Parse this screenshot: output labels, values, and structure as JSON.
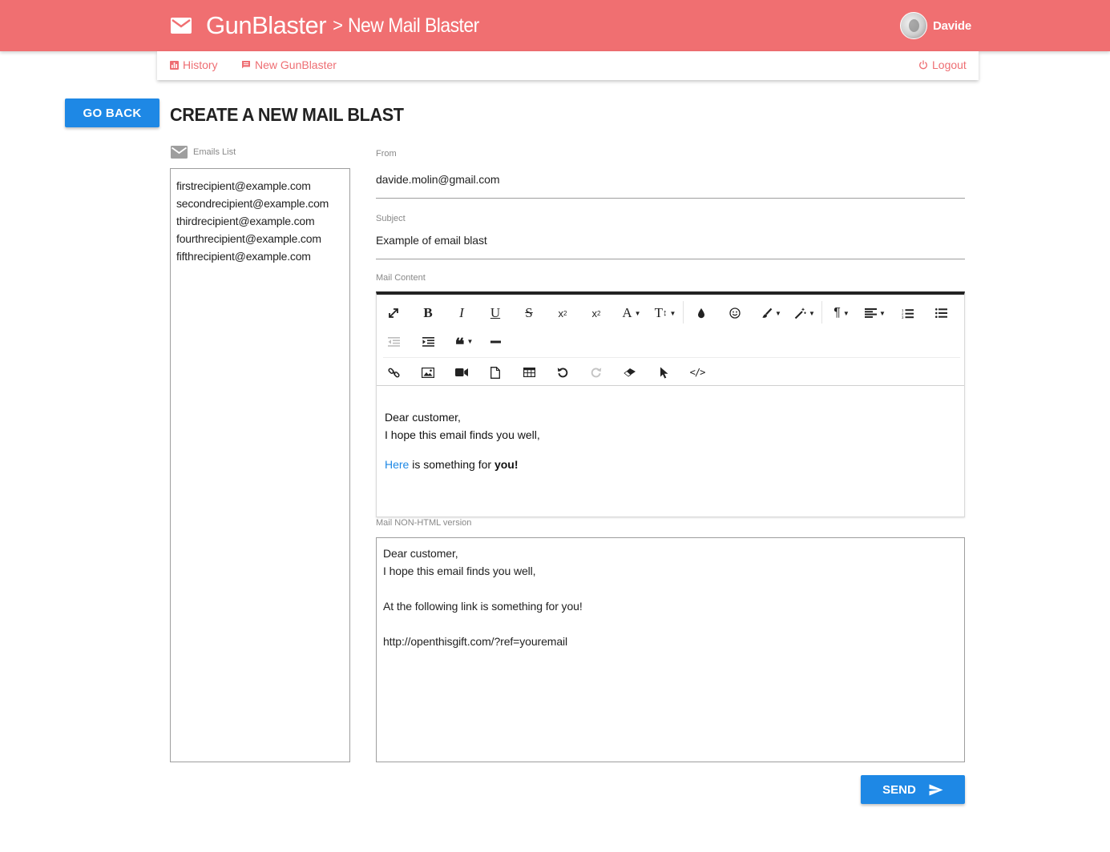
{
  "header": {
    "app_name": "GunBlaster",
    "separator": ">",
    "page_name": "New Mail Blaster",
    "user_name": "Davide",
    "background_color": "#f06f71"
  },
  "nav": {
    "history": "History",
    "new_gunblaster": "New GunBlaster",
    "logout": "Logout",
    "link_color": "#ee6e73"
  },
  "page": {
    "go_back": "GO BACK",
    "title": "CREATE A NEW MAIL BLAST"
  },
  "emails": {
    "label": "Emails List",
    "list": [
      "firstrecipient@example.com",
      "secondrecipient@example.com",
      "thirdrecipient@example.com",
      "fourthrecipient@example.com",
      "fifthrecipient@example.com"
    ]
  },
  "form": {
    "from_label": "From",
    "from_value": "davide.molin@gmail.com",
    "subject_label": "Subject",
    "subject_value": "Example of email blast",
    "content_label": "Mail Content",
    "plain_label": "Mail NON-HTML version"
  },
  "editor": {
    "toolbar_icons": [
      "fullscreen-icon",
      "bold-icon",
      "italic-icon",
      "underline-icon",
      "strikethrough-icon",
      "subscript-icon",
      "superscript-icon",
      "font-family-icon",
      "font-size-icon",
      "color-icon",
      "emoticon-icon",
      "paint-brush-icon",
      "magic-wand-icon",
      "paragraph-icon",
      "align-icon",
      "ordered-list-icon",
      "unordered-list-icon",
      "outdent-icon",
      "indent-icon",
      "quote-icon",
      "horizontal-rule-icon",
      "link-icon",
      "image-icon",
      "video-icon",
      "file-icon",
      "table-icon",
      "undo-icon",
      "redo-icon",
      "eraser-icon",
      "select-all-icon",
      "code-view-icon"
    ],
    "content": {
      "greeting": "Dear customer,",
      "line2": "I hope this email finds you well,",
      "link_text": "Here",
      "middle_text": " is something for ",
      "bold_text": "you!"
    }
  },
  "plain": {
    "lines": [
      "Dear customer,",
      "I hope this email finds you well,",
      "",
      "At the following link is something for you!",
      "",
      "http://openthisgift.com/?ref=youremail"
    ]
  },
  "send": {
    "label": "SEND",
    "color": "#1e88e5"
  }
}
